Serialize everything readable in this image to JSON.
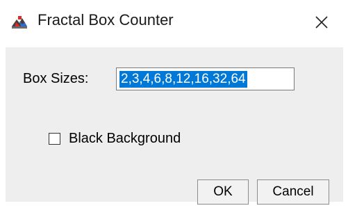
{
  "window": {
    "title": "Fractal Box Counter",
    "icon": "imagej-app-icon",
    "close_icon": "close-icon"
  },
  "form": {
    "box_sizes_label": "Box Sizes:",
    "box_sizes_value": "2,3,4,6,8,12,16,32,64",
    "black_background_label": "Black Background",
    "black_background_checked": false
  },
  "buttons": {
    "ok_label": "OK",
    "cancel_label": "Cancel"
  },
  "colors": {
    "selection": "#0078d7",
    "client_bg": "#eeeeee"
  }
}
